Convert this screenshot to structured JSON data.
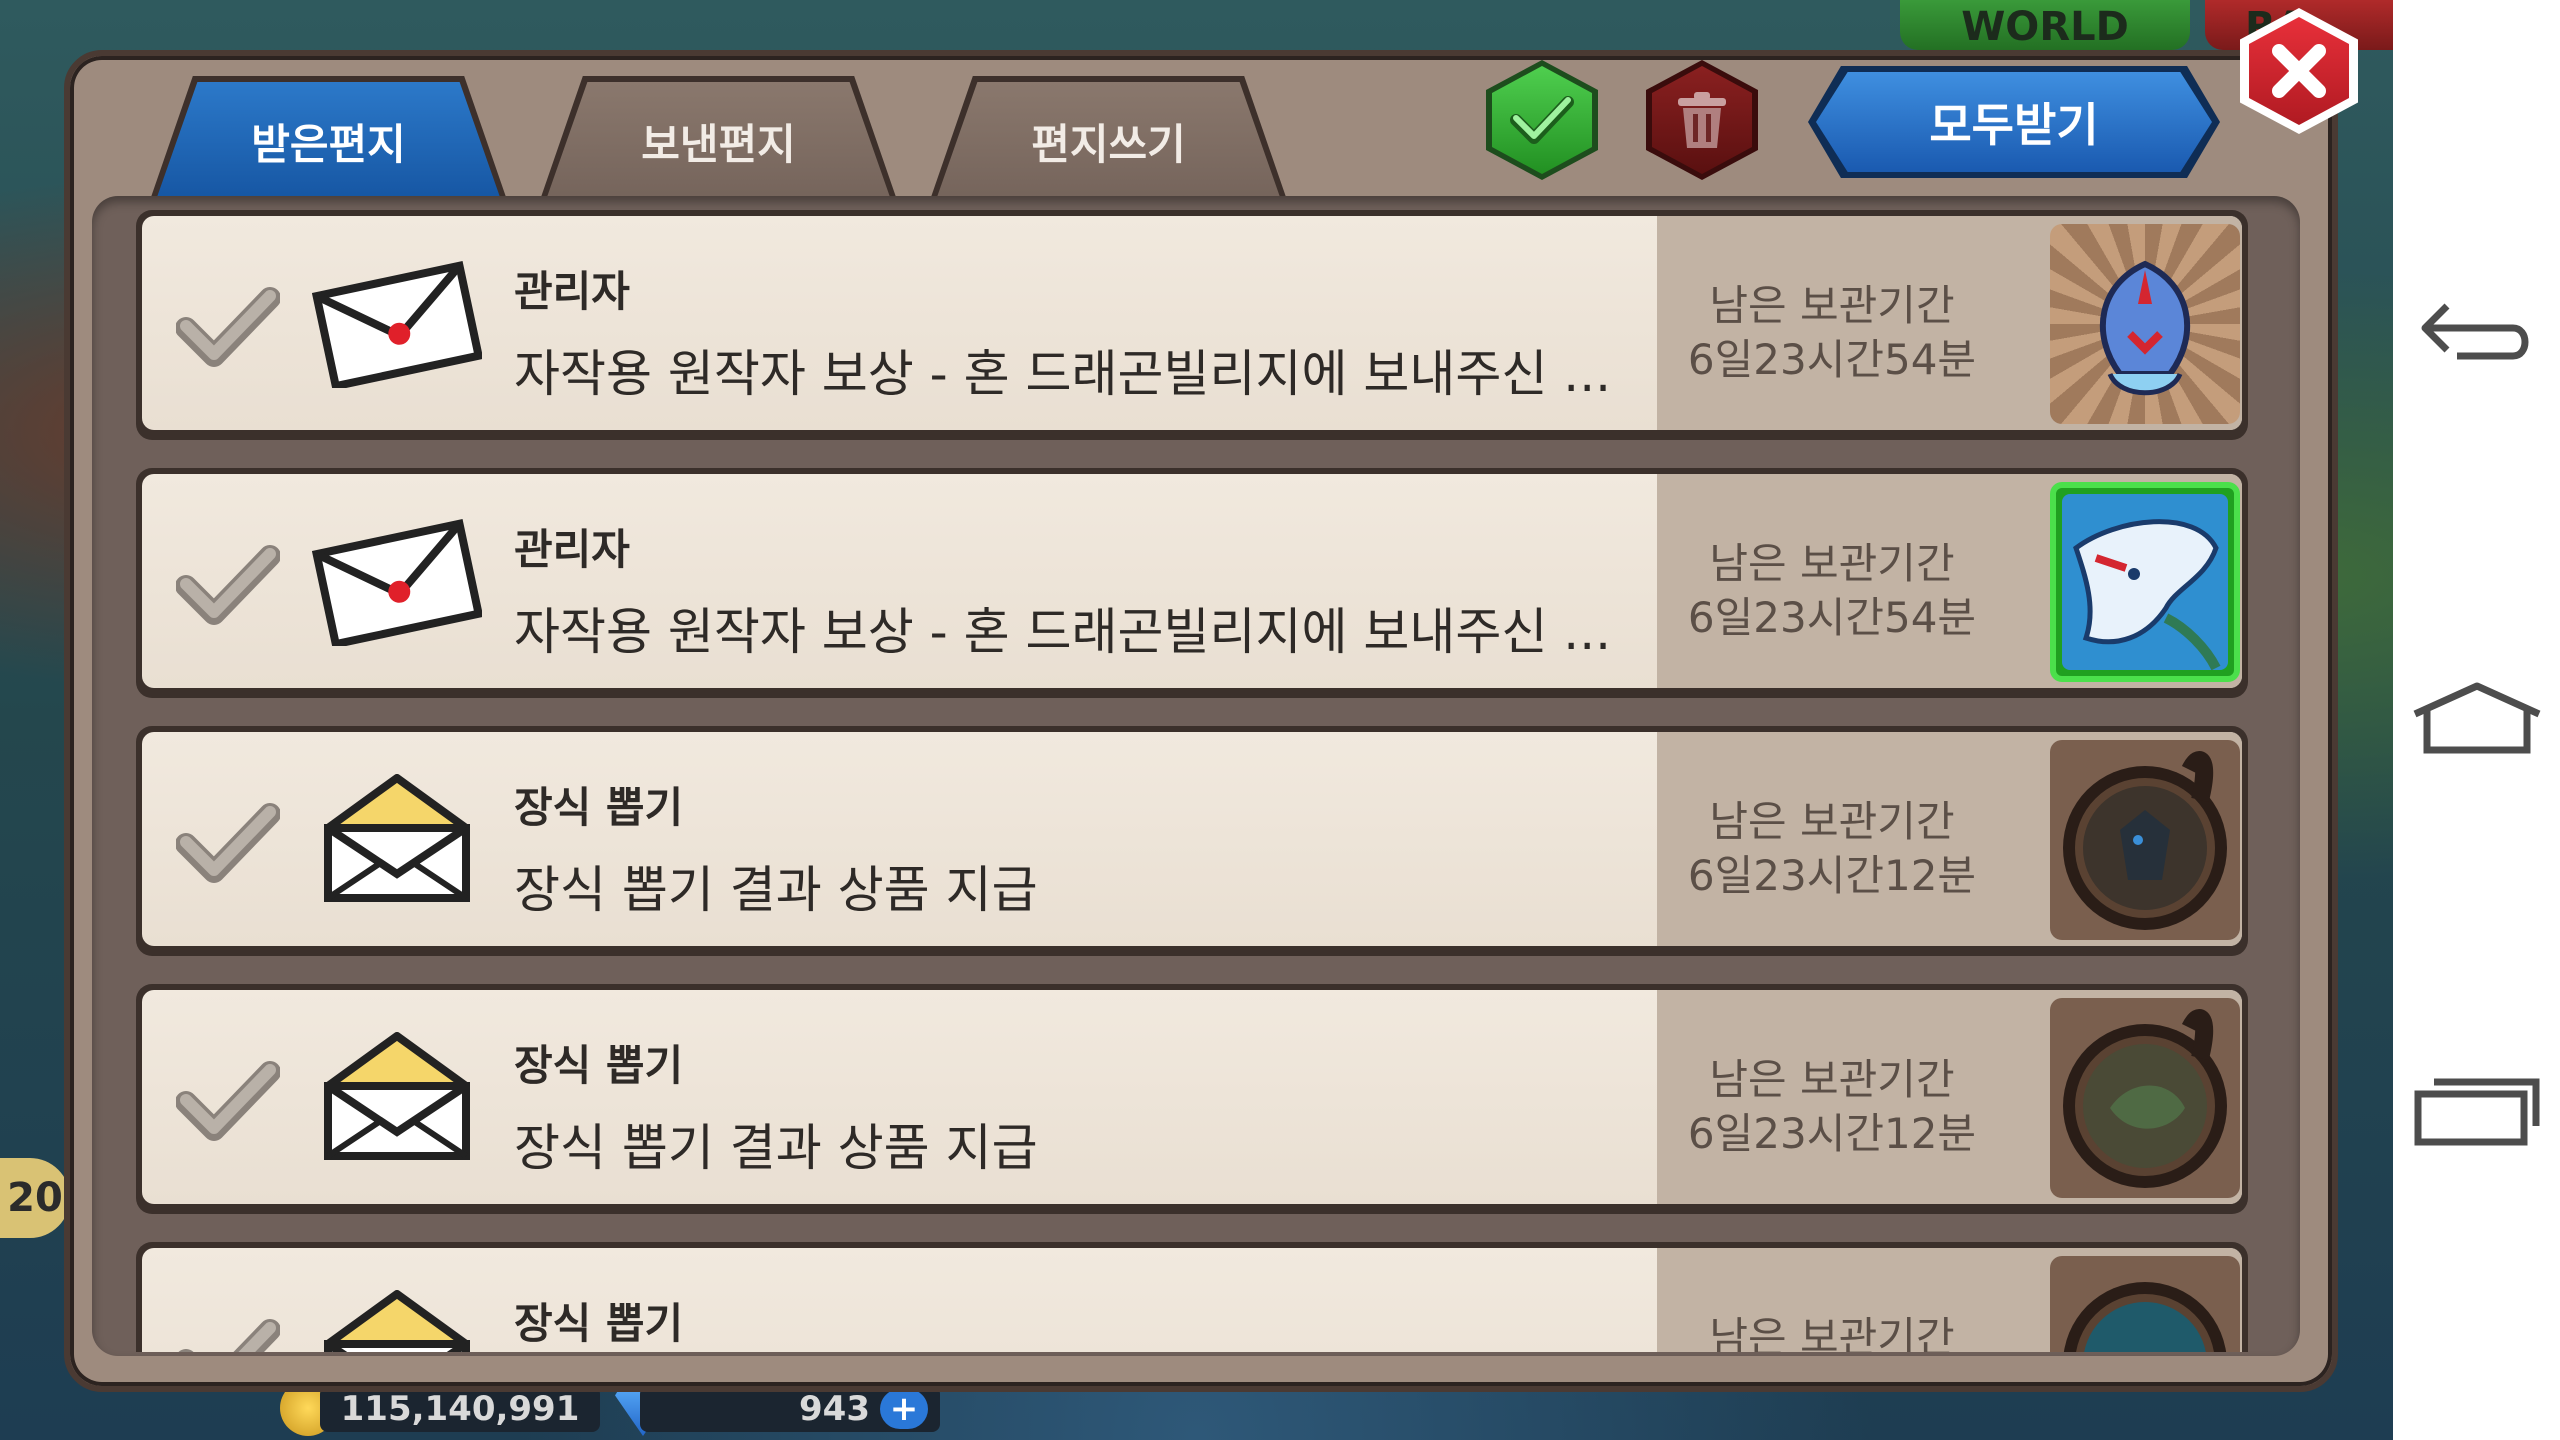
{
  "background": {
    "top_tabs": [
      "WORLD",
      "RA"
    ],
    "hud": {
      "level": "20",
      "gold": "115,140,991",
      "gems": "943",
      "plus": "+"
    }
  },
  "mailbox": {
    "tabs": [
      {
        "label": "받은편지",
        "active": true
      },
      {
        "label": "보낸편지",
        "active": false
      },
      {
        "label": "편지쓰기",
        "active": false
      }
    ],
    "receive_all_label": "모두받기",
    "colors": {
      "active_tab": "#1a62b2",
      "confirm": "#2fa82f",
      "delete": "#7a1a1a",
      "close": "#d42630"
    },
    "rows": [
      {
        "sender": "관리자",
        "subject": "자작용 원작자 보상 - 혼 드래곤빌리지에 보내주신 ...",
        "expire_label": "남은 보관기간",
        "expire_value": "6일23시간54분",
        "envelope": "sealed-red",
        "item_icon": "blue-helmet-item"
      },
      {
        "sender": "관리자",
        "subject": "자작용 원작자 보상 - 혼 드래곤빌리지에 보내주신 ...",
        "expire_label": "남은 보관기간",
        "expire_value": "6일23시간54분",
        "envelope": "sealed-red",
        "item_icon": "blue-dragon-item"
      },
      {
        "sender": "장식 뽑기",
        "subject": "장식 뽑기 결과 상품 지급",
        "expire_label": "남은 보관기간",
        "expire_value": "6일23시간12분",
        "envelope": "yellow",
        "item_icon": "dark-frame-item"
      },
      {
        "sender": "장식 뽑기",
        "subject": "장식 뽑기 결과 상품 지급",
        "expire_label": "남은 보관기간",
        "expire_value": "6일23시간12분",
        "envelope": "yellow",
        "item_icon": "dark-frame-item"
      },
      {
        "sender": "장식 뽑기",
        "subject": "",
        "expire_label": "남은 보관기간",
        "expire_value": "",
        "envelope": "yellow",
        "item_icon": "dark-frame-item"
      }
    ]
  }
}
